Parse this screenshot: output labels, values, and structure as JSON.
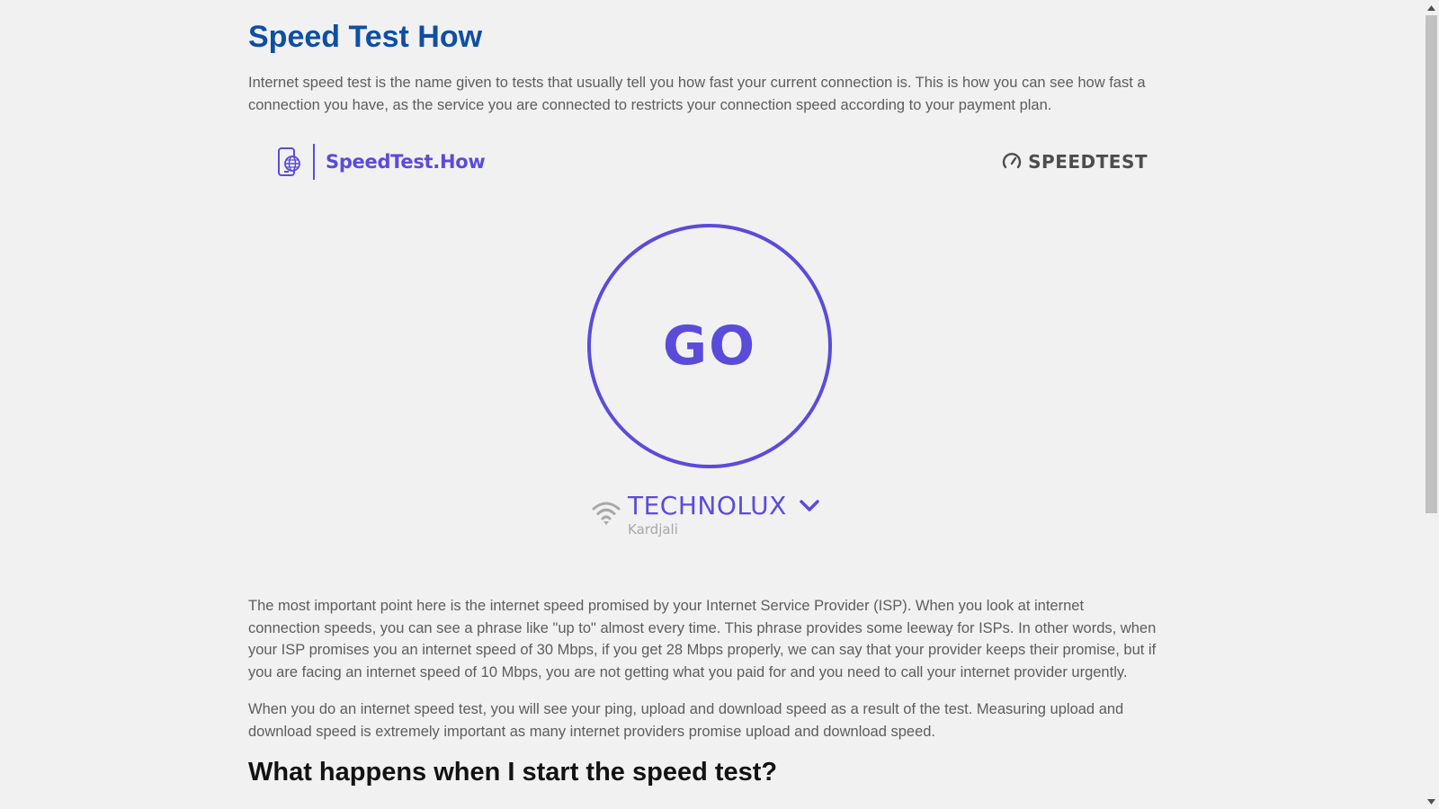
{
  "page": {
    "title": "Speed Test How",
    "intro": "Internet speed test is the name given to tests that usually tell you how fast your current connection is. This is how you can see how fast a connection you have, as the service you are connected to restricts your connection speed according to your payment plan."
  },
  "widget": {
    "brand_name": "SpeedTest.How",
    "partner_logo": "SPEEDTEST",
    "go_label": "GO",
    "isp_name": "TECHNOLUX",
    "isp_location": "Kardjali",
    "accent_color": "#5b4bdb"
  },
  "article": {
    "paragraph1": "The most important point here is the internet speed promised by your Internet Service Provider (ISP). When you look at internet connection speeds, you can see a phrase like \"up to\" almost every time. This phrase provides some leeway for ISPs. In other words, when your ISP promises you an internet speed of 30 Mbps, if you get 28 Mbps properly, we can say that your provider keeps their promise, but if you are facing an internet speed of 10 Mbps, you are not getting what you paid for and you need to call your internet provider urgently.",
    "paragraph2": "When you do an internet speed test, you will see your ping, upload and download speed as a result of the test. Measuring upload and download speed is extremely important as many internet providers promise upload and download speed.",
    "heading2": "What happens when I start the speed test?"
  },
  "colors": {
    "title": "#0e4fa3",
    "body_text": "#5d5d5d",
    "background": "#f1f1f1"
  },
  "icons": {
    "brand": "phone-globe-icon",
    "partner": "speedometer-icon",
    "connection": "wifi-icon",
    "isp_toggle": "chevron-down-icon"
  }
}
